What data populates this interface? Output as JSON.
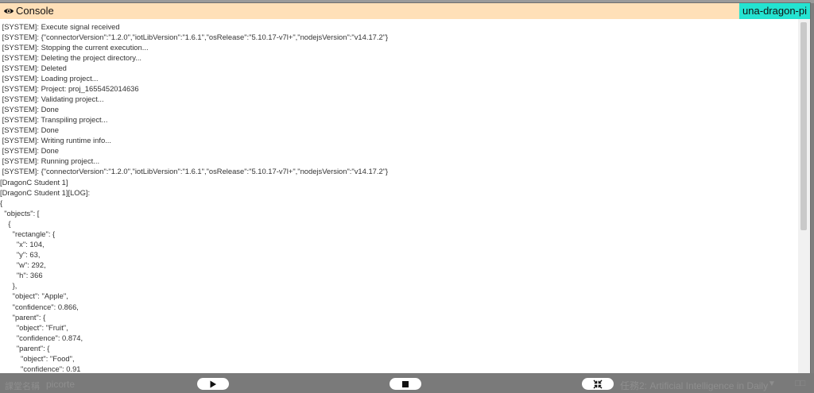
{
  "console": {
    "title": "Console",
    "device": "una-dragon-pi",
    "lines": [
      " [SYSTEM]: Execute signal received",
      " [SYSTEM]: {\"connectorVersion\":\"1.2.0\",\"iotLibVersion\":\"1.6.1\",\"osRelease\":\"5.10.17-v7l+\",\"nodejsVersion\":\"v14.17.2\"}",
      " [SYSTEM]: Stopping the current execution...",
      " [SYSTEM]: Deleting the project directory...",
      " [SYSTEM]: Deleted",
      " [SYSTEM]: Loading project...",
      " [SYSTEM]: Project: proj_1655452014636",
      " [SYSTEM]: Validating project...",
      " [SYSTEM]: Done",
      " [SYSTEM]: Transpiling project...",
      " [SYSTEM]: Done",
      " [SYSTEM]: Writing runtime info...",
      " [SYSTEM]: Done",
      " [SYSTEM]: Running project...",
      " [SYSTEM]: {\"connectorVersion\":\"1.2.0\",\"iotLibVersion\":\"1.6.1\",\"osRelease\":\"5.10.17-v7l+\",\"nodejsVersion\":\"v14.17.2\"}",
      "[DragonC Student 1]",
      "[DragonC Student 1][LOG]:",
      "{",
      "  \"objects\": [",
      "    {",
      "      \"rectangle\": {",
      "        \"x\": 104,",
      "        \"y\": 63,",
      "        \"w\": 292,",
      "        \"h\": 366",
      "      },",
      "      \"object\": \"Apple\",",
      "      \"confidence\": 0.866,",
      "      \"parent\": {",
      "        \"object\": \"Fruit\",",
      "        \"confidence\": 0.874,",
      "        \"parent\": {",
      "          \"object\": \"Food\",",
      "          \"confidence\": 0.91"
    ]
  },
  "bottom_bar": {
    "left_label": "課堂名稱",
    "left_value": "picorte",
    "right_label": "任務2: Artificial Intelligence in Daily",
    "right_end": "□□"
  },
  "colors": {
    "header_bg": "#ffe0b8",
    "badge_bg": "#24e3d1"
  }
}
